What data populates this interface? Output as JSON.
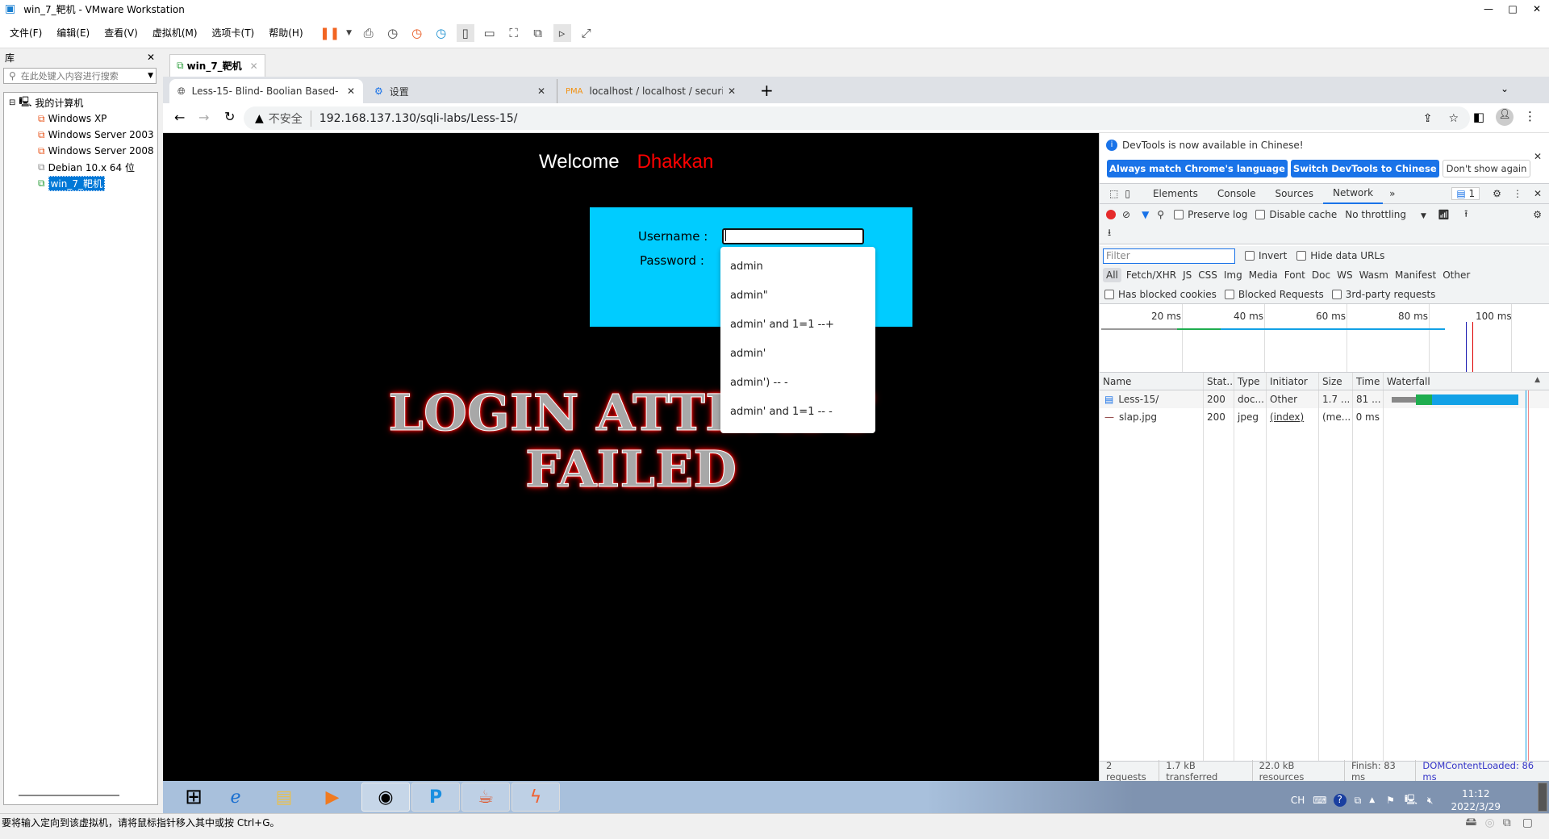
{
  "window": {
    "title": "win_7_靶机 - VMware Workstation",
    "controls": [
      "—",
      "□",
      "✕"
    ]
  },
  "menu": [
    "文件(F)",
    "编辑(E)",
    "查看(V)",
    "虚拟机(M)",
    "选项卡(T)",
    "帮助(H)"
  ],
  "library": {
    "title": "库",
    "close": "✕",
    "search_placeholder": "在此处键入内容进行搜索",
    "root": "我的计算机",
    "items": [
      "Windows XP",
      "Windows Server 2003",
      "Windows Server 2008",
      "Debian 10.x 64 位",
      "win_7_靶机"
    ],
    "selected": "win_7_靶机"
  },
  "vm_tab": {
    "label": "win_7_靶机",
    "close": "✕"
  },
  "browser": {
    "tabs": [
      {
        "label": "Less-15- Blind- Boolian Based-",
        "close": "✕"
      },
      {
        "label": "设置",
        "close": "✕"
      },
      {
        "label": "localhost / localhost / security",
        "close": "✕"
      }
    ],
    "new_tab": "+",
    "insecure_label": "不安全",
    "url": "192.168.137.130/sqli-labs/Less-15/"
  },
  "page": {
    "welcome": "Welcome",
    "name": "Dhakkan",
    "username_label": "Username :",
    "password_label": "Password :",
    "username_value": "",
    "autocomplete": [
      "admin",
      "admin\"",
      "admin' and 1=1 --+",
      "admin'",
      "admin') -- -",
      "admin' and 1=1 -- -"
    ],
    "failed_line1": "LOGIN ATTEMPT",
    "failed_line2": "FAILED",
    "colors": {
      "form_bg": "#00ccff",
      "name": "#ff0000"
    }
  },
  "devtools": {
    "notice": "DevTools is now available in Chinese!",
    "btn_match": "Always match Chrome's language",
    "btn_switch": "Switch DevTools to Chinese",
    "btn_dont": "Don't show again",
    "tabs": [
      "Elements",
      "Console",
      "Sources",
      "Network"
    ],
    "active_tab": "Network",
    "more": "»",
    "issues_count": "1",
    "preserve_log": "Preserve log",
    "disable_cache": "Disable cache",
    "throttling": "No throttling",
    "filter_placeholder": "Filter",
    "invert": "Invert",
    "hide_data_urls": "Hide data URLs",
    "types": [
      "All",
      "Fetch/XHR",
      "JS",
      "CSS",
      "Img",
      "Media",
      "Font",
      "Doc",
      "WS",
      "Wasm",
      "Manifest",
      "Other"
    ],
    "has_blocked_cookies": "Has blocked cookies",
    "blocked_requests": "Blocked Requests",
    "third_party": "3rd-party requests",
    "overview_ticks": [
      "20 ms",
      "40 ms",
      "60 ms",
      "80 ms",
      "100 ms"
    ],
    "columns": [
      "Name",
      "Stat...",
      "Type",
      "Initiator",
      "Size",
      "Time",
      "Waterfall"
    ],
    "rows": [
      {
        "name": "Less-15/",
        "status": "200",
        "type": "doc...",
        "initiator": "Other",
        "size": "1.7 ...",
        "time": "81 ..."
      },
      {
        "name": "slap.jpg",
        "status": "200",
        "type": "jpeg",
        "initiator": "(index)",
        "size": "(me...",
        "time": "0 ms"
      }
    ],
    "footer": [
      "2 requests",
      "1.7 kB transferred",
      "22.0 kB resources",
      "Finish: 83 ms",
      "DOMContentLoaded: 86 ms"
    ]
  },
  "taskbar": {
    "ime": "CH",
    "time": "11:12",
    "date": "2022/3/29"
  },
  "statusbar": "要将输入定向到该虚拟机，请将鼠标指针移入其中或按 Ctrl+G。"
}
